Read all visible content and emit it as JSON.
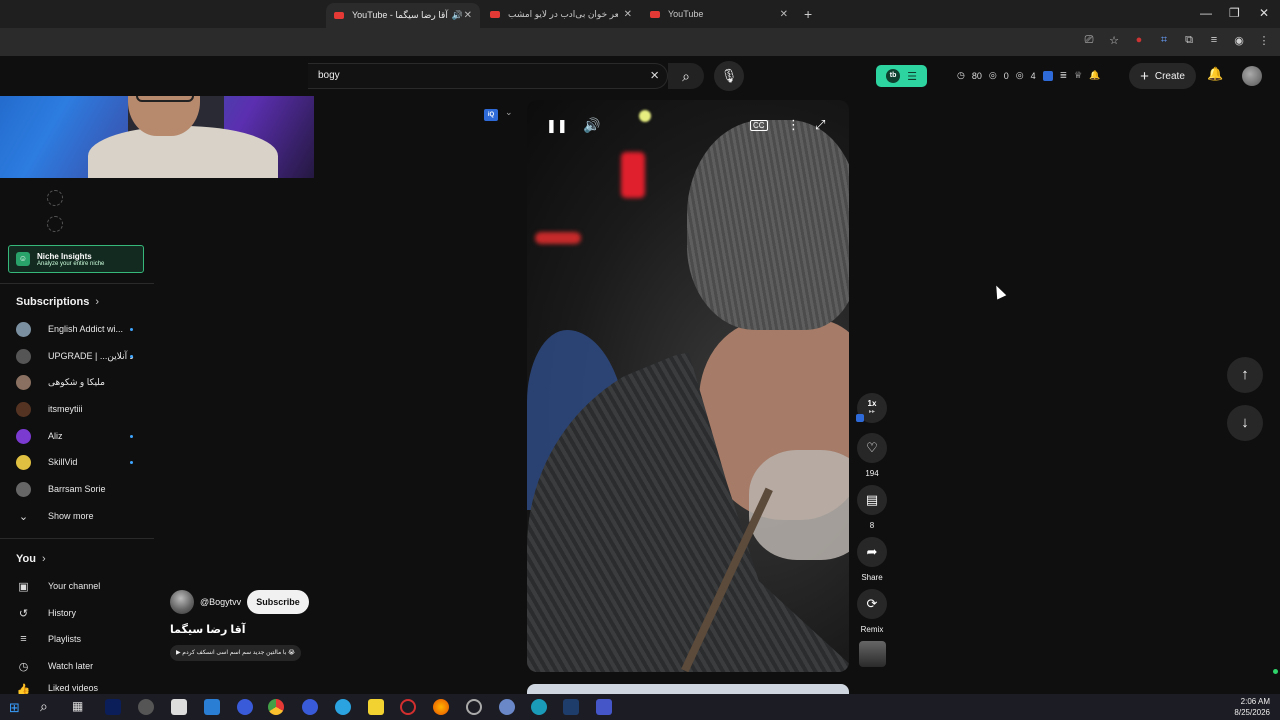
{
  "browser": {
    "tabs": [
      {
        "label": "YouTube - آقا رضا سیگما",
        "active": true,
        "audio": true
      },
      {
        "label": "مرد شعر خوان بی‌ادب در لایو امشب",
        "active": false
      },
      {
        "label": "YouTube",
        "active": false
      }
    ],
    "new_tab_symbol": "+",
    "window_controls": [
      "—",
      "❐",
      "✕"
    ]
  },
  "header": {
    "search_value": "bogy",
    "create_label": "Create",
    "stats": {
      "views": "80",
      "likes": "0",
      "eyes": "4"
    }
  },
  "sidebar": {
    "niche": {
      "title": "Niche Insights",
      "subtitle": "Analyze your entire niche"
    },
    "subscriptions_title": "Subscriptions",
    "subscriptions": [
      {
        "name": "English Addict wi...",
        "new": true,
        "color": "#7a8fa0"
      },
      {
        "name": "UPGRADE | ...د آنلاین",
        "new": true,
        "color": "#555555"
      },
      {
        "name": "ملیکا و شکوهی",
        "new": false,
        "color": "#8a7060"
      },
      {
        "name": "itsmeytiii",
        "new": false,
        "color": "#553322"
      },
      {
        "name": "Aliz",
        "new": true,
        "color": "#7b3ad0"
      },
      {
        "name": "SkillVid",
        "new": true,
        "color": "#e0c040"
      },
      {
        "name": "Barrsam Sorie",
        "new": false,
        "color": "#666666"
      }
    ],
    "show_more": "Show more",
    "you_title": "You",
    "you_items": [
      {
        "label": "Your channel",
        "icon": "person-box-icon"
      },
      {
        "label": "History",
        "icon": "history-icon"
      },
      {
        "label": "Playlists",
        "icon": "playlists-icon"
      },
      {
        "label": "Watch later",
        "icon": "clock-icon"
      },
      {
        "label": "Liked videos",
        "icon": "thumb-up-icon"
      }
    ]
  },
  "short": {
    "channel_handle": "@Bogytvv",
    "subscribe_label": "Subscribe",
    "title": "آقا رضا سیگما",
    "suggestion": "▶ با مالتین جدید سم اسم اسی انسکف کردم 😭",
    "speed": "1x",
    "likes": "194",
    "comments": "8",
    "share_label": "Share",
    "remix_label": "Remix",
    "iq_label": "iQ"
  },
  "taskbar": {
    "time": "2:06 AM",
    "date": "8/25/2026"
  },
  "colors": {
    "accent_green": "#2dd4a0",
    "youtube_red": "#e53935",
    "link_blue": "#3ea6ff"
  }
}
